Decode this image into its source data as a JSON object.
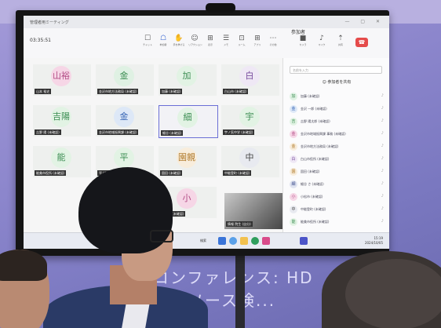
{
  "window": {
    "title": "管理者用ミーティング",
    "controls": "— ▢ ✕"
  },
  "toolbar": {
    "timer": "03:35:51",
    "tools": [
      {
        "icon": "chat-icon",
        "glyph": "☐",
        "label": "チャット"
      },
      {
        "icon": "people-icon",
        "glyph": "☖",
        "label": "参加者"
      },
      {
        "icon": "raise-hand-icon",
        "glyph": "✋",
        "label": "手を挙げる"
      },
      {
        "icon": "reaction-icon",
        "glyph": "☺",
        "label": "リアクション"
      },
      {
        "icon": "view-icon",
        "glyph": "⊞",
        "label": "表示"
      },
      {
        "icon": "notes-icon",
        "glyph": "☰",
        "label": "メモ"
      },
      {
        "icon": "rooms-icon",
        "glyph": "⊡",
        "label": "ルーム"
      },
      {
        "icon": "apps-icon",
        "glyph": "⊞",
        "label": "アプリ"
      },
      {
        "icon": "more-icon",
        "glyph": "⋯",
        "label": "その他"
      }
    ],
    "media": [
      {
        "icon": "camera-icon",
        "glyph": "■",
        "label": "カメラ"
      },
      {
        "icon": "mic-icon",
        "glyph": "♪",
        "label": "マイク"
      },
      {
        "icon": "share-icon",
        "glyph": "⇡",
        "label": "共有"
      }
    ],
    "leave_glyph": "☎",
    "leave_label": "退出"
  },
  "participants_grid": [
    {
      "initial": "山裕",
      "name": "山本 裕史",
      "color": "#f6d6e6",
      "text": "#b34d86"
    },
    {
      "initial": "金",
      "name": "金沢市地方法務局 (未確認)",
      "color": "#dff1e3",
      "text": "#3b8d52"
    },
    {
      "initial": "加",
      "name": "加藤 (未確認)",
      "color": "#e2f3e4",
      "text": "#3b8d52"
    },
    {
      "initial": "白",
      "name": "白山市 (未確認)",
      "color": "#efe8f5",
      "text": "#7b4fa0"
    },
    {
      "initial": "吉陽",
      "name": "吉野 陽 (未確認)",
      "color": "#e2f3e4",
      "text": "#3b8d52"
    },
    {
      "initial": "金",
      "name": "金沢市地域振興課 (未確認)",
      "color": "#dde8f7",
      "text": "#3866b5"
    },
    {
      "initial": "細",
      "name": "細谷 (未確認)",
      "color": "#e2f3e4",
      "text": "#3b8d52"
    },
    {
      "initial": "宇",
      "name": "宇ノ気中学 (未確認)",
      "color": "#e2f3e4",
      "text": "#3b8d52"
    },
    {
      "initial": "能",
      "name": "能美市役所 (未確認)",
      "color": "#e2f3e4",
      "text": "#3b8d52"
    },
    {
      "initial": "平",
      "name": "平 (未確認)",
      "color": "#e2f3e4",
      "text": "#3b8d52"
    },
    {
      "initial": "園親",
      "name": "園田 (未確認)",
      "color": "#f8eddc",
      "text": "#b07a2a"
    },
    {
      "initial": "中",
      "name": "中能登町 (未確認)",
      "color": "#e8eaf0",
      "text": "#444"
    },
    {
      "initial": "",
      "name": "",
      "color": "#eef0ee",
      "text": "#444"
    },
    {
      "initial": "",
      "name": "",
      "color": "#eef0ee",
      "text": "#444"
    },
    {
      "initial": "小",
      "name": "小松市 (未確認)",
      "color": "#f6d6e6",
      "text": "#b34d86"
    }
  ],
  "video_tile": {
    "name": "情報 院生 (自分)"
  },
  "panel": {
    "title": "参加者",
    "search_placeholder": "名前を入力",
    "invite_label": "☺ 参加者を共有",
    "people": [
      {
        "initial": "加",
        "name": "加藤 (未確認)",
        "color": "#dff1e3",
        "text": "#3b8d52"
      },
      {
        "initial": "金",
        "name": "金沢 一郎 (未確認)",
        "color": "#dde8f7",
        "text": "#3866b5"
      },
      {
        "initial": "吉",
        "name": "吉野 陽太郎 (未確認)",
        "color": "#e2f3e4",
        "text": "#3b8d52"
      },
      {
        "initial": "金",
        "name": "金沢市地域振興課 事務 (未確認)",
        "color": "#f6d6e6",
        "text": "#b34d86"
      },
      {
        "initial": "金",
        "name": "金沢市地方法務局 (未確認)",
        "color": "#f8eddc",
        "text": "#b07a2a"
      },
      {
        "initial": "白",
        "name": "白山市役所 (未確認)",
        "color": "#efe8f5",
        "text": "#7b4fa0"
      },
      {
        "initial": "園",
        "name": "園田 (未確認)",
        "color": "#f8eddc",
        "text": "#b07a2a"
      },
      {
        "initial": "細",
        "name": "細谷 さ (未確認)",
        "color": "#dfe3f0",
        "text": "#3b4a8a"
      },
      {
        "initial": "小",
        "name": "小松市 (未確認)",
        "color": "#f6d6e6",
        "text": "#b34d86"
      },
      {
        "initial": "中",
        "name": "中能登町 (未確認)",
        "color": "#e8eaf0",
        "text": "#444"
      },
      {
        "initial": "能",
        "name": "能美市役所 (未確認)",
        "color": "#e2f3e4",
        "text": "#3b8d52"
      }
    ]
  },
  "taskbar": {
    "search_text": "検索",
    "clock_time": "15:19",
    "clock_date": "2024/10/05"
  },
  "projection": {
    "line1": "コンファレンス: HD",
    "line2": "入力ソース検..."
  }
}
